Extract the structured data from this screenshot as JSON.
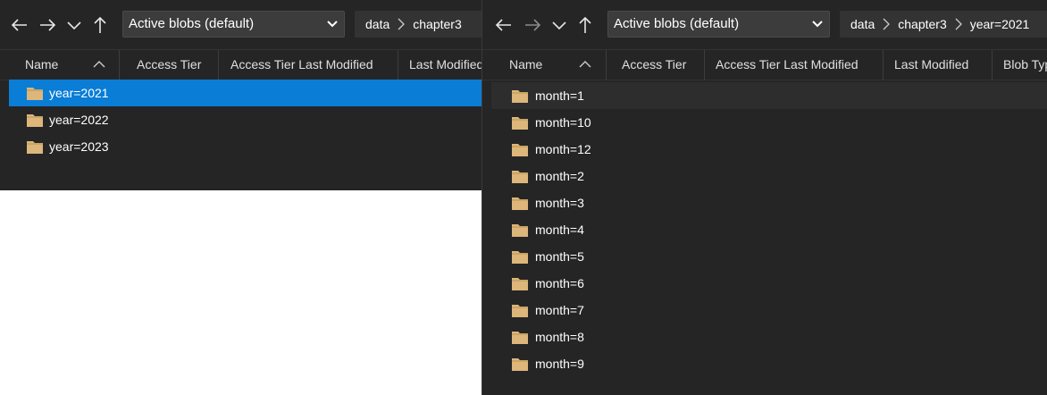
{
  "left": {
    "filter": {
      "selected": "Active blobs (default)"
    },
    "breadcrumb": [
      "data",
      "chapter3"
    ],
    "columns": [
      "Name",
      "Access Tier",
      "Access Tier Last Modified",
      "Last Modified"
    ],
    "rows": [
      {
        "name": "year=2021",
        "selected": true
      },
      {
        "name": "year=2022"
      },
      {
        "name": "year=2023"
      }
    ]
  },
  "right": {
    "filter": {
      "selected": "Active blobs (default)"
    },
    "breadcrumb": [
      "data",
      "chapter3",
      "year=2021"
    ],
    "columns": [
      "Name",
      "Access Tier",
      "Access Tier Last Modified",
      "Last Modified",
      "Blob Type"
    ],
    "rows": [
      {
        "name": "month=1",
        "hover": true
      },
      {
        "name": "month=10"
      },
      {
        "name": "month=12"
      },
      {
        "name": "month=2"
      },
      {
        "name": "month=3"
      },
      {
        "name": "month=4"
      },
      {
        "name": "month=5"
      },
      {
        "name": "month=6"
      },
      {
        "name": "month=7"
      },
      {
        "name": "month=8"
      },
      {
        "name": "month=9"
      }
    ]
  },
  "icons": {
    "back": "arrow-left-icon",
    "forward": "arrow-right-icon",
    "recent": "chevron-down-icon",
    "up": "arrow-up-icon",
    "folder": "folder-icon",
    "sort": "sort-up-icon"
  },
  "colors": {
    "background": "#252526",
    "selection": "#0a7dd6",
    "folder": "#dcb67a"
  }
}
